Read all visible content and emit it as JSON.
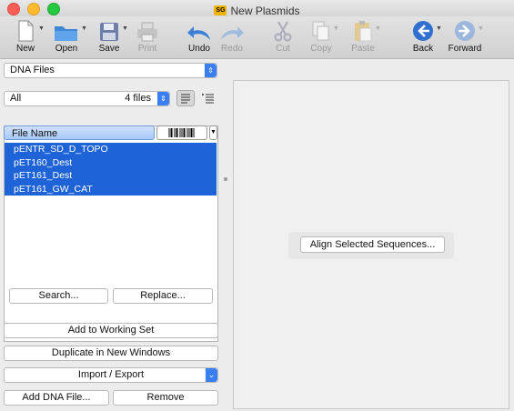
{
  "window": {
    "title": "New Plasmids",
    "app_badge": "SG"
  },
  "toolbar": {
    "new": "New",
    "open": "Open",
    "save": "Save",
    "print": "Print",
    "undo": "Undo",
    "redo": "Redo",
    "cut": "Cut",
    "copy": "Copy",
    "paste": "Paste",
    "back": "Back",
    "forward": "Forward"
  },
  "sidebar": {
    "collection_select": "DNA Files",
    "filter_select": "All",
    "file_count": "4 files",
    "column_header": "File Name",
    "files": [
      "pENTR_SD_D_TOPO",
      "pET160_Dest",
      "pET161_Dest",
      "pET161_GW_CAT"
    ],
    "search_label": "Search...",
    "replace_label": "Replace...",
    "add_working_set": "Add to Working Set",
    "duplicate_windows": "Duplicate in New Windows",
    "import_export": "Import / Export",
    "add_dna_file": "Add DNA File...",
    "remove": "Remove"
  },
  "main": {
    "align_label": "Align Selected Sequences..."
  },
  "colors": {
    "selection": "#1f63d9",
    "accent": "#3a7ef5"
  }
}
